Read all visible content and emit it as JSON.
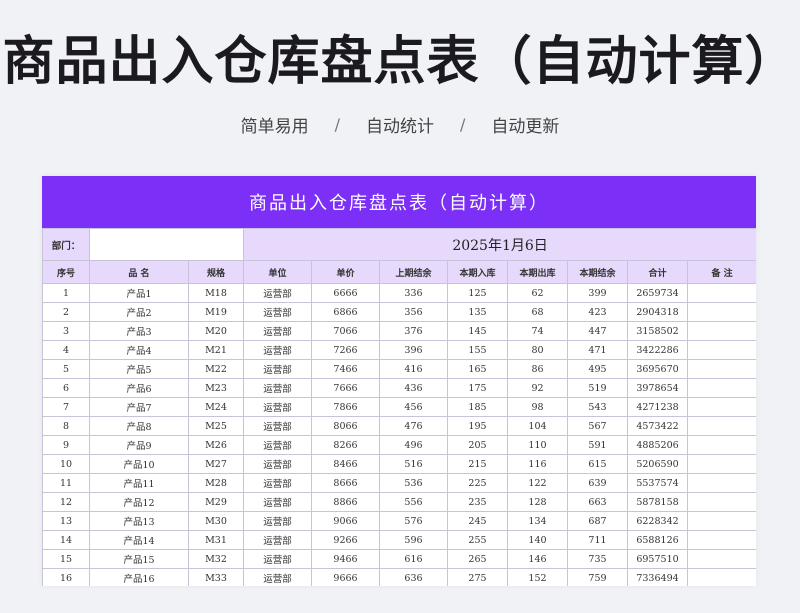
{
  "hero": {
    "title": "商品出入仓库盘点表（自动计算）",
    "tag1": "简单易用",
    "tag2": "自动统计",
    "tag3": "自动更新",
    "sep": "/"
  },
  "sheet": {
    "title": "商品出入仓库盘点表（自动计算）",
    "dept_label": "部门：",
    "dept_value": "",
    "date": "2025年1月6日",
    "columns": [
      "序号",
      "品  名",
      "规格",
      "单位",
      "单价",
      "上期结余",
      "本期入库",
      "本期出库",
      "本期结余",
      "合计",
      "备  注"
    ],
    "rows": [
      [
        "1",
        "产品1",
        "M18",
        "运营部",
        "6666",
        "336",
        "125",
        "62",
        "399",
        "2659734",
        ""
      ],
      [
        "2",
        "产品2",
        "M19",
        "运营部",
        "6866",
        "356",
        "135",
        "68",
        "423",
        "2904318",
        ""
      ],
      [
        "3",
        "产品3",
        "M20",
        "运营部",
        "7066",
        "376",
        "145",
        "74",
        "447",
        "3158502",
        ""
      ],
      [
        "4",
        "产品4",
        "M21",
        "运营部",
        "7266",
        "396",
        "155",
        "80",
        "471",
        "3422286",
        ""
      ],
      [
        "5",
        "产品5",
        "M22",
        "运营部",
        "7466",
        "416",
        "165",
        "86",
        "495",
        "3695670",
        ""
      ],
      [
        "6",
        "产品6",
        "M23",
        "运营部",
        "7666",
        "436",
        "175",
        "92",
        "519",
        "3978654",
        ""
      ],
      [
        "7",
        "产品7",
        "M24",
        "运营部",
        "7866",
        "456",
        "185",
        "98",
        "543",
        "4271238",
        ""
      ],
      [
        "8",
        "产品8",
        "M25",
        "运营部",
        "8066",
        "476",
        "195",
        "104",
        "567",
        "4573422",
        ""
      ],
      [
        "9",
        "产品9",
        "M26",
        "运营部",
        "8266",
        "496",
        "205",
        "110",
        "591",
        "4885206",
        ""
      ],
      [
        "10",
        "产品10",
        "M27",
        "运营部",
        "8466",
        "516",
        "215",
        "116",
        "615",
        "5206590",
        ""
      ],
      [
        "11",
        "产品11",
        "M28",
        "运营部",
        "8666",
        "536",
        "225",
        "122",
        "639",
        "5537574",
        ""
      ],
      [
        "12",
        "产品12",
        "M29",
        "运营部",
        "8866",
        "556",
        "235",
        "128",
        "663",
        "5878158",
        ""
      ],
      [
        "13",
        "产品13",
        "M30",
        "运营部",
        "9066",
        "576",
        "245",
        "134",
        "687",
        "6228342",
        ""
      ],
      [
        "14",
        "产品14",
        "M31",
        "运营部",
        "9266",
        "596",
        "255",
        "140",
        "711",
        "6588126",
        ""
      ],
      [
        "15",
        "产品15",
        "M32",
        "运营部",
        "9466",
        "616",
        "265",
        "146",
        "735",
        "6957510",
        ""
      ],
      [
        "16",
        "产品16",
        "M33",
        "运营部",
        "9666",
        "636",
        "275",
        "152",
        "759",
        "7336494",
        ""
      ]
    ]
  },
  "colors": {
    "accent": "#7b2ff7",
    "header_bg": "#e6d9fb",
    "border": "#c9c3d9"
  }
}
